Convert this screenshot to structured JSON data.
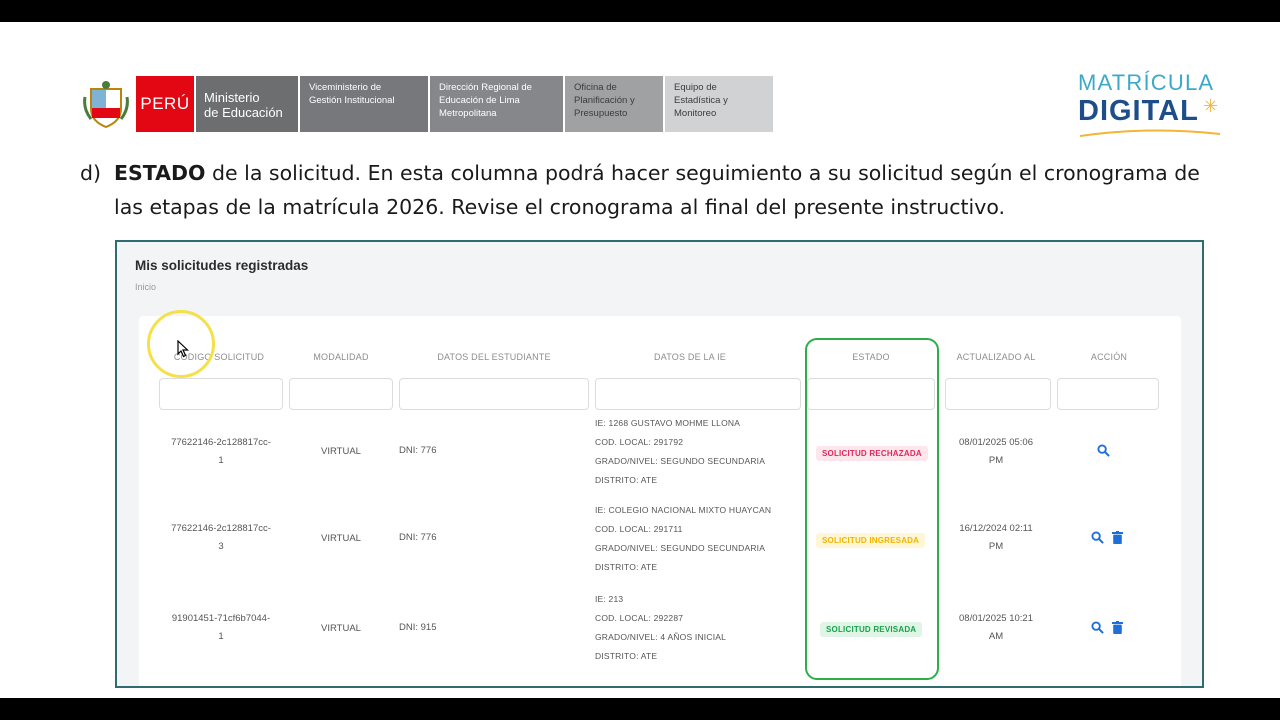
{
  "header": {
    "logos": {
      "peru": "PERÚ",
      "ministerio": [
        "Ministerio",
        "de Educación"
      ],
      "viceministerio": [
        "Viceministerio de",
        "Gestión Institucional"
      ],
      "direccion": [
        "Dirección Regional de",
        "Educación de Lima",
        "Metropolitana"
      ],
      "oficina": [
        "Oficina de",
        "Planificación y",
        "Presupuesto"
      ],
      "equipo": [
        "Equipo de",
        "Estadística y",
        "Monitoreo"
      ]
    },
    "brand": {
      "top": "MATRÍCULA",
      "bottom": "DIGITAL"
    }
  },
  "instruction": {
    "label": "d)",
    "bold": "ESTADO",
    "rest_line1": " de la solicitud. En esta columna podrá hacer seguimiento a su solicitud según el cronograma de",
    "line2": "las etapas de la matrícula 2026. Revise el cronograma al final del presente instructivo."
  },
  "panel": {
    "title": "Mis solicitudes registradas",
    "breadcrumb": "Inicio",
    "columns": [
      "CÓDIGO SOLICITUD",
      "MODALIDAD",
      "DATOS DEL ESTUDIANTE",
      "DATOS DE LA IE",
      "ESTADO",
      "ACTUALIZADO AL",
      "ACCIÓN"
    ],
    "rows": [
      {
        "code": [
          "77622146-2c128817cc-",
          "1"
        ],
        "modalidad": "VIRTUAL",
        "estudiante": "DNI: 776",
        "ie": [
          "IE: 1268 GUSTAVO MOHME LLONA",
          "COD. LOCAL: 291792",
          "GRADO/NIVEL: SEGUNDO SECUNDARIA",
          "DISTRITO: ATE"
        ],
        "estado": "SOLICITUD RECHAZADA",
        "actualizado": [
          "08/01/2025 05:06",
          "PM"
        ]
      },
      {
        "code": [
          "77622146-2c128817cc-",
          "3"
        ],
        "modalidad": "VIRTUAL",
        "estudiante": "DNI: 776",
        "ie": [
          "IE: COLEGIO NACIONAL MIXTO HUAYCAN",
          "COD. LOCAL: 291711",
          "GRADO/NIVEL: SEGUNDO SECUNDARIA",
          "DISTRITO: ATE"
        ],
        "estado": "SOLICITUD INGRESADA",
        "actualizado": [
          "16/12/2024 02:11",
          "PM"
        ]
      },
      {
        "code": [
          "91901451-71cf6b7044-",
          "1"
        ],
        "modalidad": "VIRTUAL",
        "estudiante": "DNI: 915",
        "ie": [
          "IE: 213",
          "COD. LOCAL: 292287",
          "GRADO/NIVEL: 4 AÑOS INICIAL",
          "DISTRITO: ATE"
        ],
        "estado": "SOLICITUD REVISADA",
        "actualizado": [
          "08/01/2025 10:21",
          "AM"
        ]
      }
    ]
  },
  "colors": {
    "peru_red": "#e30613",
    "rejected": "#e0285c",
    "entered": "#f3b400",
    "reviewed": "#17a34a",
    "highlight": "#2cae4a",
    "action_icon": "#1e6fd9"
  }
}
